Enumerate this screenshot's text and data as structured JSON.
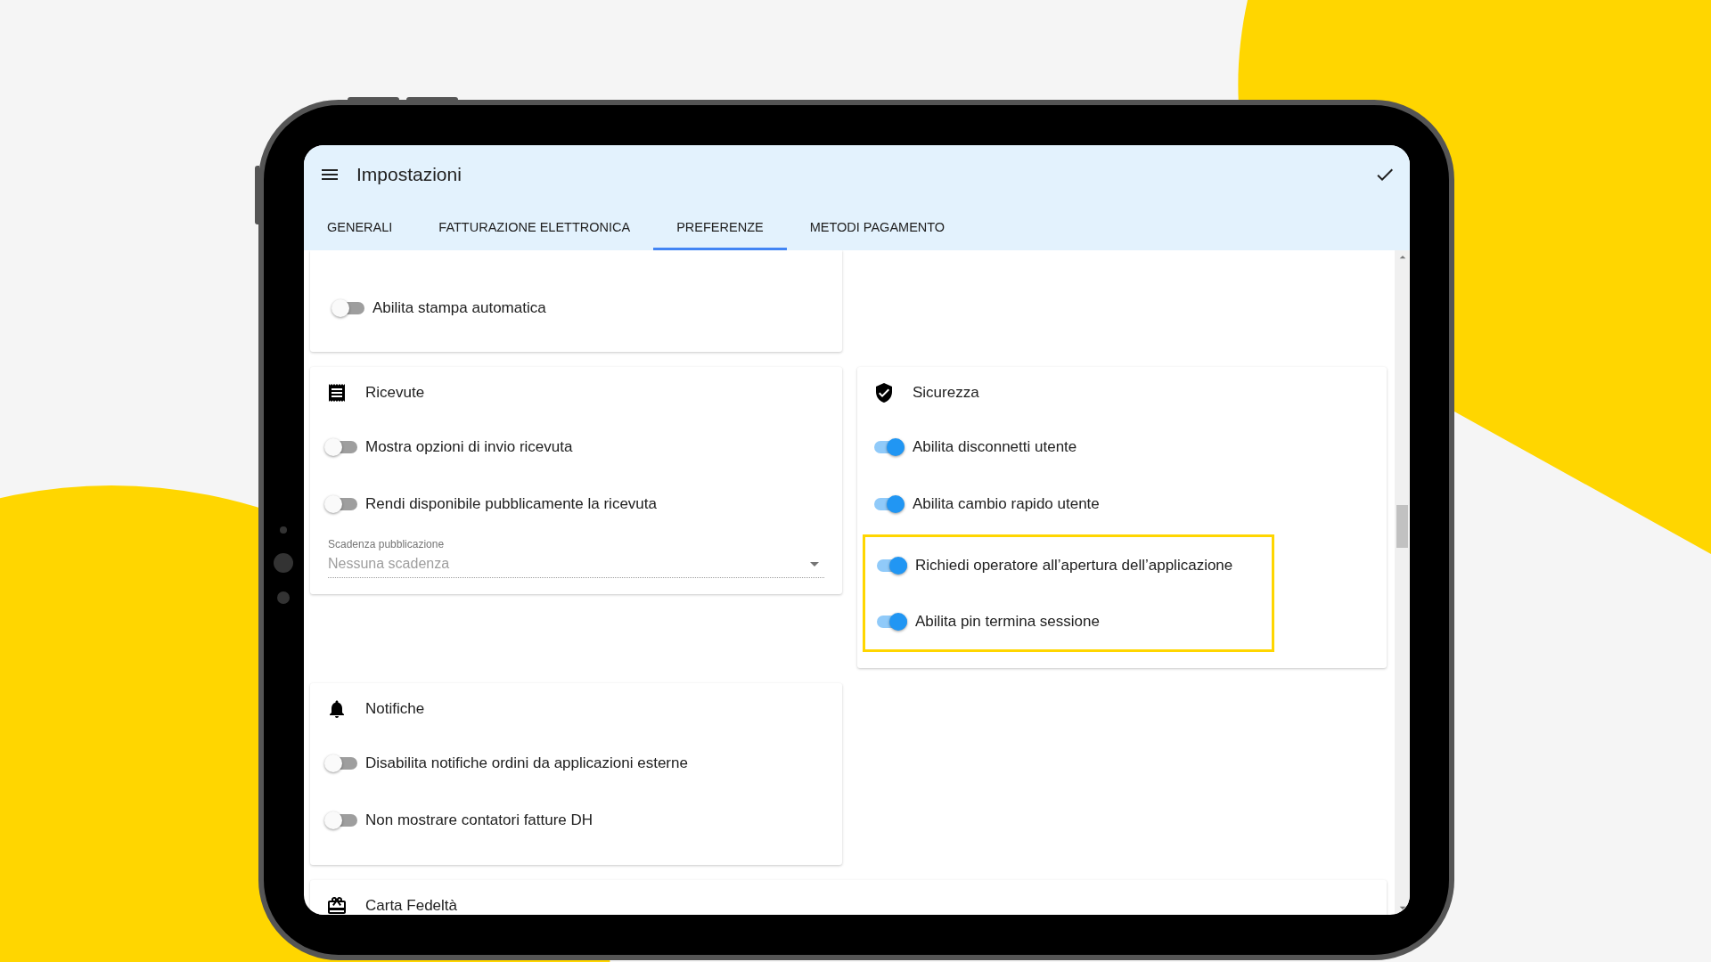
{
  "app_bar": {
    "title": "Impostazioni"
  },
  "tabs": [
    {
      "label": "GENERALI",
      "selected": false
    },
    {
      "label": "FATTURAZIONE ELETTRONICA",
      "selected": false
    },
    {
      "label": "PREFERENZE",
      "selected": true
    },
    {
      "label": "METODI PAGAMENTO",
      "selected": false
    }
  ],
  "sections": [
    {
      "items": [
        {
          "label": "Abilita stampa automatica",
          "on": false
        }
      ]
    },
    {
      "title": "Ricevute",
      "items": [
        {
          "label": "Mostra opzioni di invio ricevuta",
          "on": false
        },
        {
          "label": "Rendi disponibile pubblicamente la ricevuta",
          "on": false
        }
      ],
      "field": {
        "label": "Scadenza pubblicazione",
        "value": "Nessuna scadenza",
        "disabled": true
      }
    },
    {
      "title": "Sicurezza",
      "items": [
        {
          "label": "Abilita disconnetti utente",
          "on": true,
          "highlighted": false
        },
        {
          "label": "Abilita cambio rapido utente",
          "on": true,
          "highlighted": false
        },
        {
          "label": "Richiedi operatore all’apertura dell’applicazione",
          "on": true,
          "highlighted": true
        },
        {
          "label": "Abilita pin termina sessione",
          "on": true,
          "highlighted": true
        }
      ]
    },
    {
      "title": "Notifiche",
      "items": [
        {
          "label": "Disabilita notifiche ordini da applicazioni esterne",
          "on": false
        },
        {
          "label": "Non mostrare contatori fatture DH",
          "on": false
        }
      ]
    },
    {
      "title": "Carta Fedeltà"
    }
  ]
}
